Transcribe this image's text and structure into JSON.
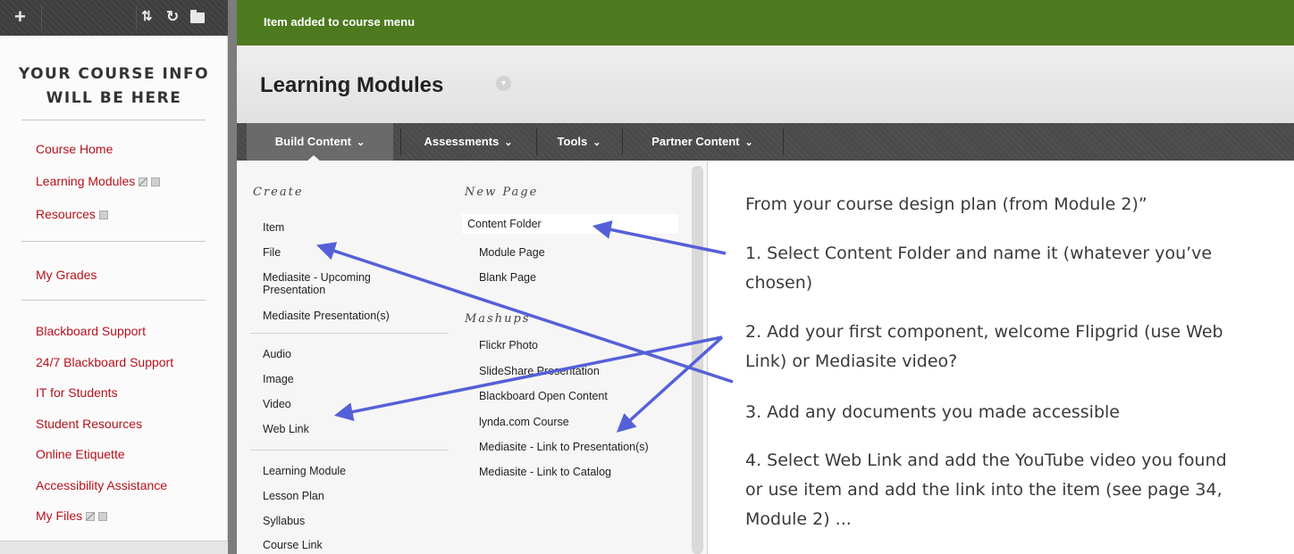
{
  "sidebar": {
    "toolbar": {
      "add_icon": "+",
      "sort_icon": "⇅",
      "refresh_icon": "↻"
    },
    "course_info_line1": "YOUR COURSE INFO",
    "course_info_line2": "WILL BE HERE",
    "links": [
      {
        "label": "Course Home"
      },
      {
        "label": "Learning Modules"
      },
      {
        "label": "Resources"
      },
      {
        "label": "My Grades"
      },
      {
        "label": "Blackboard Support"
      },
      {
        "label": "24/7 Blackboard Support"
      },
      {
        "label": "IT for Students"
      },
      {
        "label": "Student Resources"
      },
      {
        "label": "Online Etiquette"
      },
      {
        "label": "Accessibility Assistance"
      },
      {
        "label": "My Files"
      }
    ]
  },
  "notice": "Item added to course menu",
  "page_title": "Learning Modules",
  "tabs": [
    {
      "label": "Build Content"
    },
    {
      "label": "Assessments"
    },
    {
      "label": "Tools"
    },
    {
      "label": "Partner Content"
    }
  ],
  "menu": {
    "create_heading": "Create",
    "create_items": [
      "Item",
      "File",
      "Mediasite - Upcoming Presentation",
      "Mediasite Presentation(s)",
      "Audio",
      "Image",
      "Video",
      "Web Link",
      "Learning Module",
      "Lesson Plan",
      "Syllabus",
      "Course Link"
    ],
    "newpage_heading": "New Page",
    "newpage_items": [
      "Content Folder",
      "Module Page",
      "Blank Page"
    ],
    "mashups_heading": "Mashups",
    "mashup_items": [
      "Flickr Photo",
      "SlideShare Presentation",
      "Blackboard Open Content",
      "lynda.com Course",
      "Mediasite - Link to Presentation(s)",
      "Mediasite - Link to Catalog"
    ]
  },
  "annotations": [
    "From your course design plan (from Module 2)”",
    "1. Select Content Folder and name it (whatever you’ve chosen)",
    "2. Add your first component, welcome Flipgrid (use Web Link) or Mediasite video?",
    "3. Add any documents you made accessible",
    "4. Select Web Link and add the YouTube video you found or use item and add the link into the item (see page 34, Module 2) ..."
  ],
  "colors": {
    "accent_green": "#4d7a1f",
    "link_red": "#b5121b",
    "arrow_blue": "#5560d8"
  }
}
